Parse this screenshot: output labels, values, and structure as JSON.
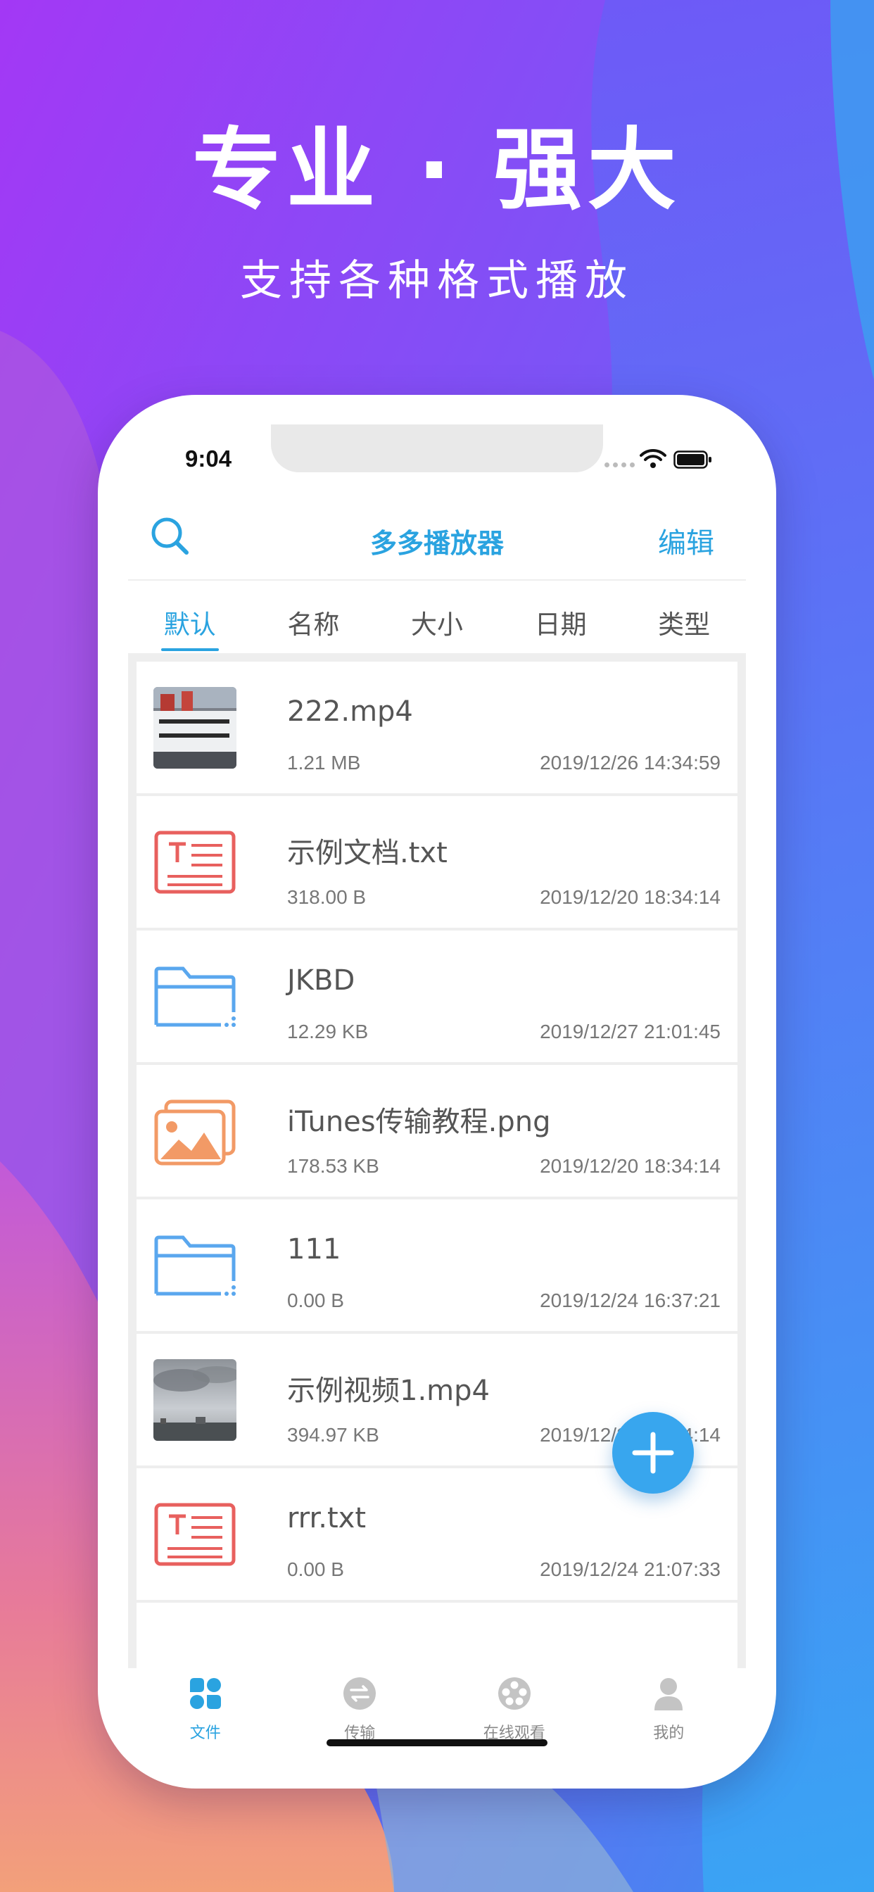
{
  "promo": {
    "title": "专业 · 强大",
    "subtitle": "支持各种格式播放"
  },
  "status_bar": {
    "time": "9:04"
  },
  "navbar": {
    "title": "多多播放器",
    "edit_label": "编辑"
  },
  "sort_tabs": [
    {
      "label": "默认",
      "active": true
    },
    {
      "label": "名称",
      "active": false
    },
    {
      "label": "大小",
      "active": false
    },
    {
      "label": "日期",
      "active": false
    },
    {
      "label": "类型",
      "active": false
    }
  ],
  "files": [
    {
      "name": "222.mp4",
      "size": "1.21 MB",
      "date": "2019/12/26 14:34:59",
      "icon": "video-thumbnail-banner"
    },
    {
      "name": "示例文档.txt",
      "size": "318.00 B",
      "date": "2019/12/20 18:34:14",
      "icon": "text-file-icon"
    },
    {
      "name": "JKBD",
      "size": "12.29 KB",
      "date": "2019/12/27 21:01:45",
      "icon": "folder-icon"
    },
    {
      "name": "iTunes传输教程.png",
      "size": "178.53 KB",
      "date": "2019/12/20 18:34:14",
      "icon": "image-file-icon"
    },
    {
      "name": "111",
      "size": "0.00 B",
      "date": "2019/12/24 16:37:21",
      "icon": "folder-icon"
    },
    {
      "name": "示例视频1.mp4",
      "size": "394.97 KB",
      "date": "2019/12/20 18:34:14",
      "icon": "video-thumbnail-sky"
    },
    {
      "name": "rrr.txt",
      "size": "0.00 B",
      "date": "2019/12/24 21:07:33",
      "icon": "text-file-icon"
    }
  ],
  "tabbar": [
    {
      "label": "文件",
      "icon": "files-grid-icon",
      "active": true
    },
    {
      "label": "传输",
      "icon": "transfer-icon",
      "active": false
    },
    {
      "label": "在线观看",
      "icon": "film-reel-icon",
      "active": false
    },
    {
      "label": "我的",
      "icon": "profile-icon",
      "active": false
    }
  ],
  "colors": {
    "accent": "#2aa3e0",
    "text_file": "#e8605e",
    "folder": "#5aa7ee",
    "image_file": "#f29a66",
    "fab": "#38a6ee"
  }
}
